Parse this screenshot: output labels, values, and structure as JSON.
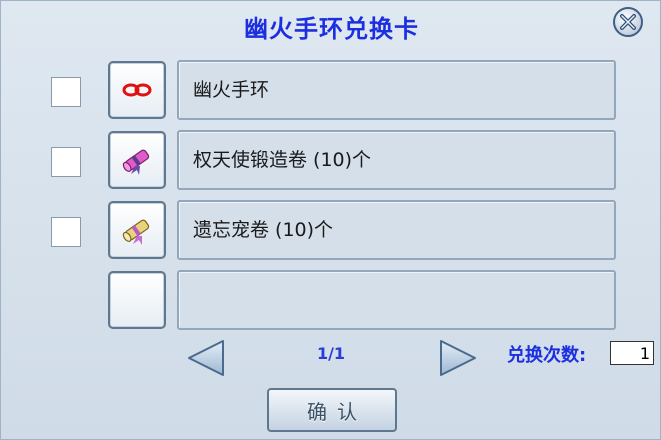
{
  "dialog": {
    "title": "幽火手环兑换卡"
  },
  "rows": [
    {
      "name": "幽火手环",
      "icon": "bracelet-icon"
    },
    {
      "name": "权天使锻造卷 (10)个",
      "icon": "scroll-pink-icon"
    },
    {
      "name": "遗忘宠卷 (10)个",
      "icon": "scroll-yellow-icon"
    },
    {
      "name": "",
      "icon": ""
    }
  ],
  "pagination": {
    "page_text": "1/1"
  },
  "exchange": {
    "count_label": "兑换次数:",
    "count_value": "1"
  },
  "confirm_label": "确认",
  "colors": {
    "title": "#1c2fe0",
    "background": "#d6e0ea"
  }
}
